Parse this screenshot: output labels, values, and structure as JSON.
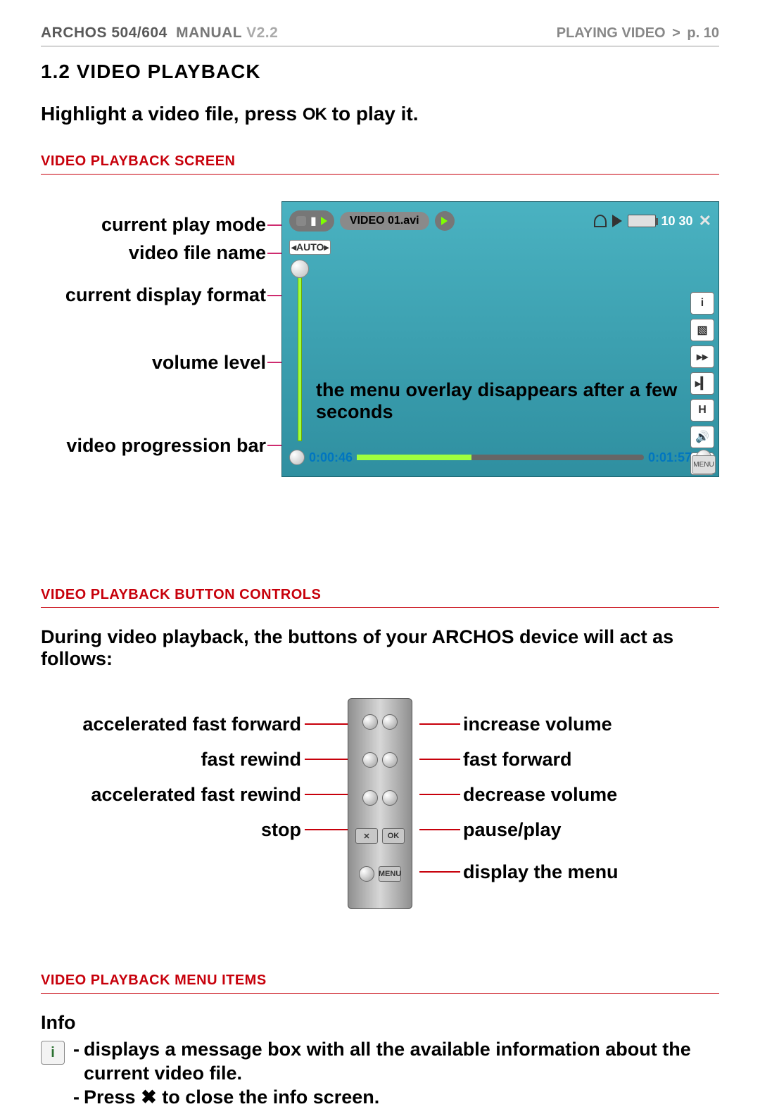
{
  "header": {
    "brand": "ARCHOS",
    "model": "504/604",
    "manual": "MANUAL",
    "version": "V2.2",
    "section_right": "PLAYING VIDEO",
    "separator": ">",
    "page": "p. 10"
  },
  "section": {
    "num_title": "1.2   VIDEO PLAYBACK",
    "intro_a": "Highlight a video file, press ",
    "intro_ok": "OK",
    "intro_b": " to play it."
  },
  "sub1": "VIDEO PLAYBACK SCREEN",
  "playback_labels": {
    "l1": "current play mode",
    "l2": "video file name",
    "l3": "current display format",
    "l4": "volume level",
    "l5": "video progression bar"
  },
  "screen": {
    "filename": "VIDEO 01.avi",
    "clock": "10 30",
    "auto": "◂AUTO▸",
    "overlay": "the menu overlay disappears after a few seconds",
    "elapsed": "0:00:46",
    "total": "0:01:57",
    "menu_label": "MENU",
    "side_icons": [
      "i",
      "▧",
      "▸▸",
      "▸▎",
      "H",
      "🔊",
      "✦"
    ]
  },
  "sub2": "VIDEO PLAYBACK BUTTON CONTROLS",
  "controls_intro": "During video playback, the buttons of your ARCHOS device will act as follows:",
  "controls": {
    "left": {
      "l1": "accelerated fast forward",
      "l2": "fast rewind",
      "l3": "accelerated fast rewind",
      "l4": "stop"
    },
    "right": {
      "r1": "increase volume",
      "r2": "fast forward",
      "r3": "decrease volume",
      "r4": "pause/play",
      "r5": "display the menu"
    },
    "device_labels": {
      "ok": "OK",
      "x": "✕",
      "menu": "MENU"
    }
  },
  "sub3": "VIDEO PLAYBACK MENU ITEMS",
  "info": {
    "heading": "Info",
    "icon_glyph": "i",
    "line1": "displays a message box with all the available information about the current video file.",
    "line2_a": "Press ",
    "line2_x": "✖",
    "line2_b": " to close the info screen."
  }
}
